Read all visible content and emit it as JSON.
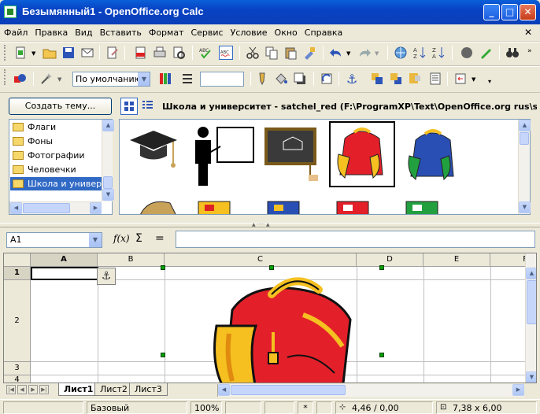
{
  "window": {
    "title": "Безымянный1 - OpenOffice.org Calc"
  },
  "menu": [
    "Файл",
    "Правка",
    "Вид",
    "Вставить",
    "Формат",
    "Сервис",
    "Условие",
    "Окно",
    "Справка"
  ],
  "toolbar2": {
    "style_value": "По умолчанию"
  },
  "gallery": {
    "create_theme_label": "Создать тему...",
    "themes": [
      "Флаги",
      "Фоны",
      "Фотографии",
      "Человечки",
      "Школа и универси"
    ],
    "selected_theme": 4,
    "path": "Школа и университет - satchel_red (F:\\ProgramXP\\Text\\OpenOffice.org rus\\share"
  },
  "formula": {
    "cell_ref": "A1",
    "sum_label": "Σ",
    "equals_label": "="
  },
  "sheet": {
    "columns": [
      "A",
      "B",
      "C",
      "D",
      "E",
      "F"
    ],
    "rows": [
      "1",
      "2",
      "3",
      "4"
    ],
    "tabs": [
      "Лист1",
      "Лист2",
      "Лист3"
    ]
  },
  "status": {
    "style": "Базовый",
    "zoom": "100%",
    "modified": "*",
    "position": "4,46 / 0,00",
    "size": "7,38 x 6,00"
  },
  "colors": {
    "title_bar": "#0842c4",
    "selection": "#316ac5",
    "satchel_red": "#e3202a"
  }
}
